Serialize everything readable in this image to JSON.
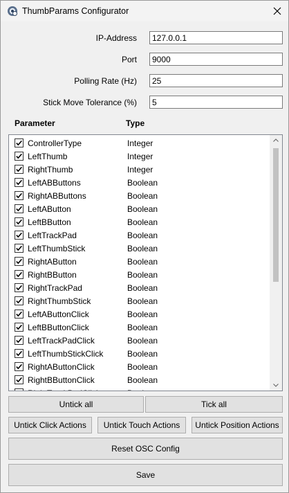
{
  "window": {
    "title": "ThumbParams Configurator",
    "icon": "app-gear-globe-icon",
    "close_icon": "close-icon"
  },
  "form": {
    "ip_label": "IP-Address",
    "ip_value": "127.0.0.1",
    "port_label": "Port",
    "port_value": "9000",
    "polling_label": "Polling Rate (Hz)",
    "polling_value": "25",
    "tolerance_label": "Stick Move Tolerance (%)",
    "tolerance_value": "5"
  },
  "table": {
    "col_parameter": "Parameter",
    "col_type": "Type",
    "rows": [
      {
        "name": "ControllerType",
        "type": "Integer",
        "checked": true
      },
      {
        "name": "LeftThumb",
        "type": "Integer",
        "checked": true
      },
      {
        "name": "RightThumb",
        "type": "Integer",
        "checked": true
      },
      {
        "name": "LeftABButtons",
        "type": "Boolean",
        "checked": true
      },
      {
        "name": "RightABButtons",
        "type": "Boolean",
        "checked": true
      },
      {
        "name": "LeftAButton",
        "type": "Boolean",
        "checked": true
      },
      {
        "name": "LeftBButton",
        "type": "Boolean",
        "checked": true
      },
      {
        "name": "LeftTrackPad",
        "type": "Boolean",
        "checked": true
      },
      {
        "name": "LeftThumbStick",
        "type": "Boolean",
        "checked": true
      },
      {
        "name": "RightAButton",
        "type": "Boolean",
        "checked": true
      },
      {
        "name": "RightBButton",
        "type": "Boolean",
        "checked": true
      },
      {
        "name": "RightTrackPad",
        "type": "Boolean",
        "checked": true
      },
      {
        "name": "RightThumbStick",
        "type": "Boolean",
        "checked": true
      },
      {
        "name": "LeftAButtonClick",
        "type": "Boolean",
        "checked": true
      },
      {
        "name": "LeftBButtonClick",
        "type": "Boolean",
        "checked": true
      },
      {
        "name": "LeftTrackPadClick",
        "type": "Boolean",
        "checked": true
      },
      {
        "name": "LeftThumbStickClick",
        "type": "Boolean",
        "checked": true
      },
      {
        "name": "RightAButtonClick",
        "type": "Boolean",
        "checked": true
      },
      {
        "name": "RightBButtonClick",
        "type": "Boolean",
        "checked": true
      },
      {
        "name": "RightTrackPadClick",
        "type": "Boolean",
        "checked": true
      }
    ]
  },
  "buttons": {
    "untick_all": "Untick all",
    "tick_all": "Tick all",
    "untick_click": "Untick Click Actions",
    "untick_touch": "Untick Touch Actions",
    "untick_position": "Untick Position Actions",
    "reset_osc": "Reset OSC Config",
    "save": "Save"
  }
}
